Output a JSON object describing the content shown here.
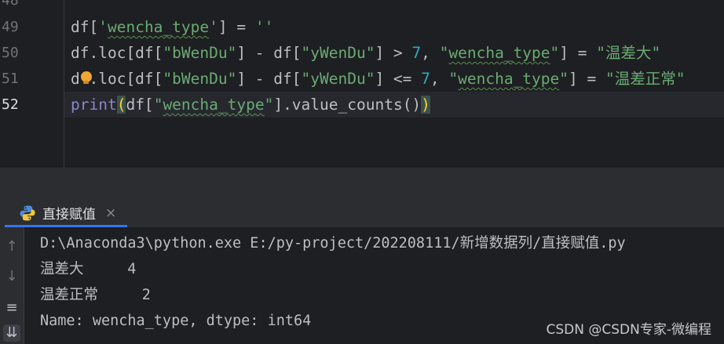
{
  "editor": {
    "line_numbers": [
      "48",
      "49",
      "50",
      "51",
      "52"
    ],
    "lines": {
      "l49": {
        "a": "df[",
        "b": "'",
        "c": "wencha_type",
        "d": "'",
        "e": "] = ",
        "f": "''"
      },
      "l50": {
        "a": "df.loc[df[",
        "b": "\"bWenDu\"",
        "c": "] - df[",
        "d": "\"yWenDu\"",
        "e": "] > ",
        "f": "7",
        "g": ", ",
        "h": "\"",
        "i": "wencha_type",
        "j": "\"",
        "k": "] = ",
        "l": "\"",
        "m": "温差大",
        "n": "\""
      },
      "l51": {
        "a": "df.loc[df[",
        "b": "\"bWenDu\"",
        "c": "] - df[",
        "d": "\"yWenDu\"",
        "e": "] <= ",
        "f": "7",
        "g": ", ",
        "h": "\"",
        "i": "wencha_type",
        "j": "\"",
        "k": "] = ",
        "l": "\"",
        "m": "温差正常",
        "n": "\""
      },
      "l52": {
        "a": "print",
        "b": "(",
        "c": "df[",
        "d": "\"",
        "e": "wencha_type",
        "f": "\"",
        "g": "].value_counts()",
        "h": ")"
      }
    }
  },
  "run": {
    "tab_label": "直接赋值",
    "close_symbol": "×",
    "toolbar": {
      "up": "↑",
      "down": "↓",
      "wrap": "≡",
      "scroll_end": "⇊"
    },
    "output": [
      "D:\\Anaconda3\\python.exe E:/py-project/202208111/新增数据列/直接赋值.py",
      "温差大     4",
      "温差正常     2",
      "Name: wencha_type, dtype: int64"
    ]
  },
  "watermark": "CSDN @CSDN专家-微编程",
  "colors": {
    "editor_bg": "#1e1f22",
    "string": "#6aab73",
    "number": "#2aacb8",
    "text": "#bcbec4",
    "accent": "#3574f0"
  }
}
